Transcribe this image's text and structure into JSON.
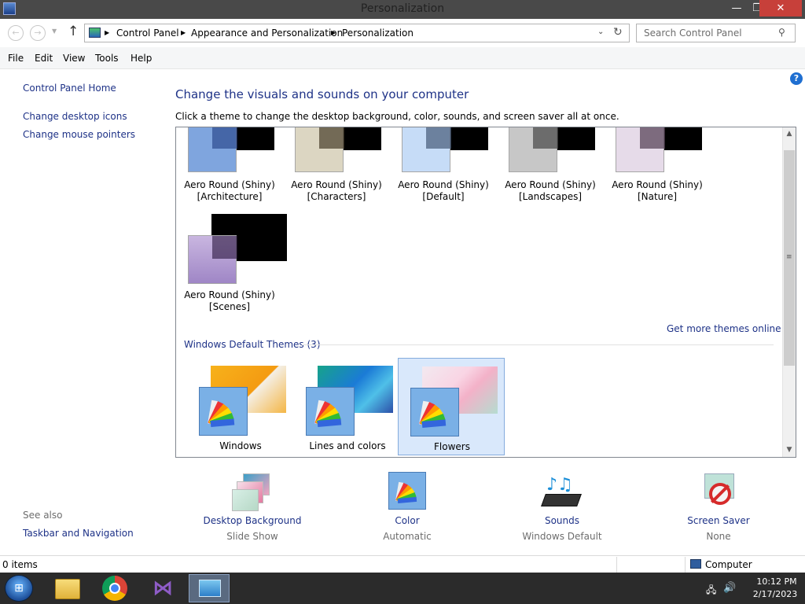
{
  "window": {
    "title": "Personalization",
    "min": "—",
    "max": "❐",
    "close": "✕"
  },
  "nav": {
    "back": "←",
    "forward": "→",
    "recent": "▼",
    "up": "↑",
    "crumbs": [
      "Control Panel",
      "Appearance and Personalization",
      "Personalization"
    ],
    "crumb_sep": "▶",
    "dropdown": "⌄",
    "refresh": "↻",
    "search_placeholder": "Search Control Panel",
    "search_glyph": "⚲"
  },
  "menu": [
    "File",
    "Edit",
    "View",
    "Tools",
    "Help"
  ],
  "left": {
    "home": "Control Panel Home",
    "links": [
      "Change desktop icons",
      "Change mouse pointers"
    ],
    "see_also": "See also",
    "see_also_links": [
      "Taskbar and Navigation"
    ]
  },
  "main": {
    "help": "?",
    "title": "Change the visuals and sounds on your computer",
    "subtitle": "Click a theme to change the desktop background, color, sounds, and screen saver all at once.",
    "themes": [
      {
        "line1": "Aero Round (Shiny)",
        "line2": "[Architecture]",
        "color": "#7fa5de"
      },
      {
        "line1": "Aero Round (Shiny)",
        "line2": "[Characters]",
        "color": "#dcd6c2"
      },
      {
        "line1": "Aero Round (Shiny)",
        "line2": "[Default]",
        "color": "#c6dcf7"
      },
      {
        "line1": "Aero Round (Shiny)",
        "line2": "[Landscapes]",
        "color": "#c7c7c7"
      },
      {
        "line1": "Aero Round (Shiny)",
        "line2": "[Nature]",
        "color": "#e6dbe9"
      }
    ],
    "scenes_theme": {
      "line1": "Aero Round (Shiny)",
      "line2": "[Scenes]"
    },
    "more_themes": "Get more themes online",
    "default_header": "Windows Default Themes (3)",
    "default_themes": [
      "Windows",
      "Lines and colors",
      "Flowers"
    ],
    "scroll": {
      "up": "▲",
      "down": "▼",
      "grip": "≡"
    }
  },
  "settings": [
    {
      "label": "Desktop Background",
      "value": "Slide Show"
    },
    {
      "label": "Color",
      "value": "Automatic"
    },
    {
      "label": "Sounds",
      "value": "Windows Default"
    },
    {
      "label": "Screen Saver",
      "value": "None"
    }
  ],
  "status": {
    "items": "0 items",
    "location": "Computer"
  },
  "taskbar": {
    "start": "⊞",
    "net": "🖧",
    "vol": "🔊",
    "time": "10:12 PM",
    "date": "2/17/2023"
  }
}
